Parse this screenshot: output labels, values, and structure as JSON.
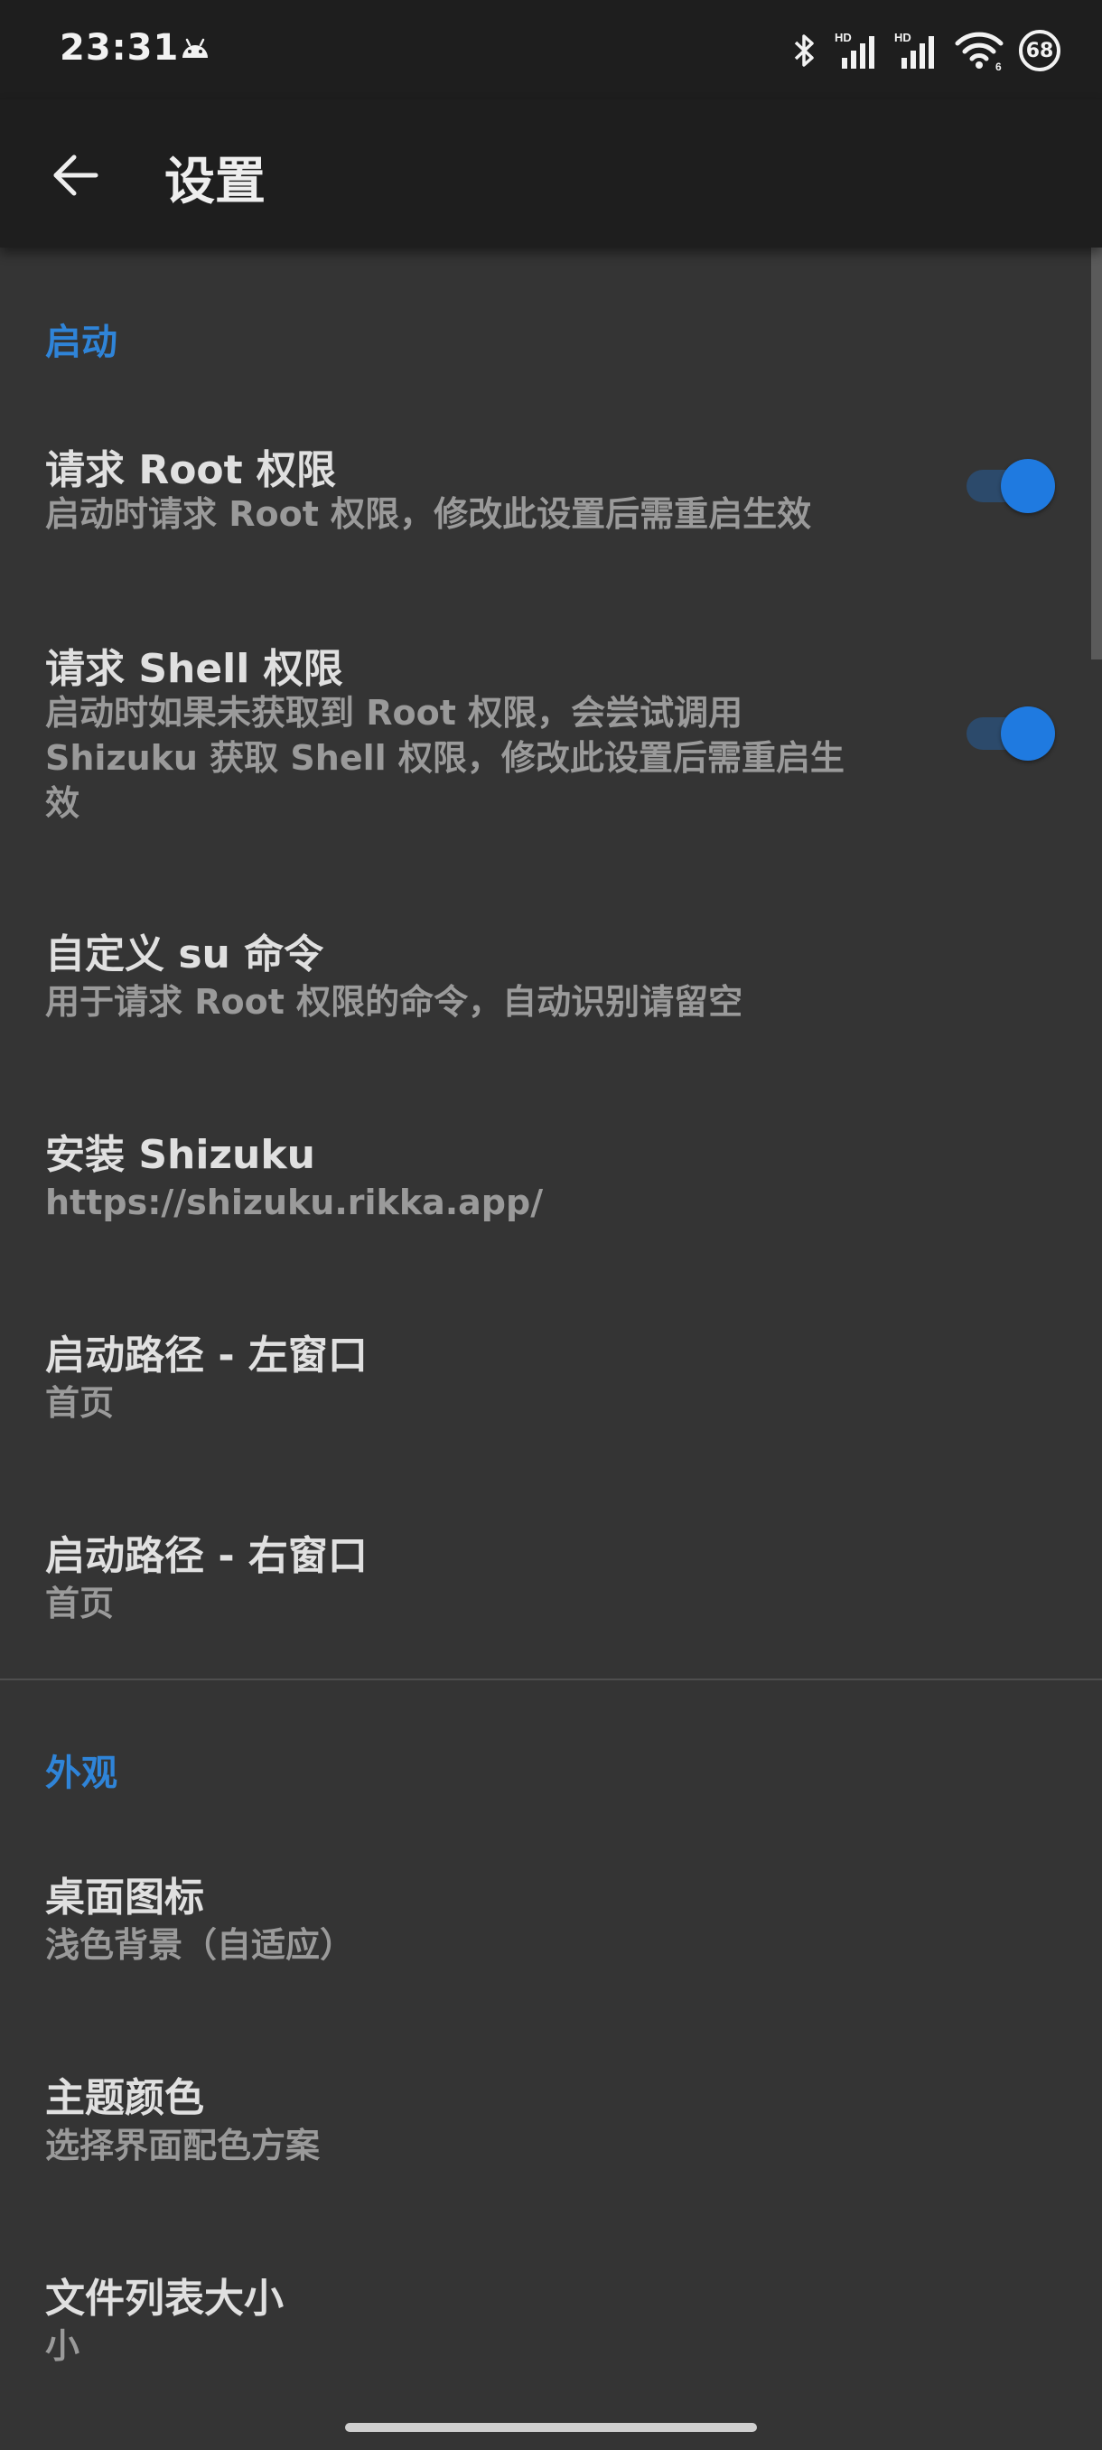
{
  "status_bar": {
    "time": "23:31",
    "battery_level": "68",
    "icons": [
      "android-icon",
      "bluetooth-icon",
      "signal-hd-icon",
      "signal-hd-icon",
      "wifi-icon",
      "battery-icon"
    ]
  },
  "app_bar": {
    "title": "设置",
    "back_icon": "arrow-back-icon"
  },
  "sections": {
    "startup": {
      "header": "启动",
      "items": [
        {
          "title": "请求 Root 权限",
          "summary": "启动时请求 Root 权限，修改此设置后需重启生效",
          "toggle": true
        },
        {
          "title": "请求 Shell 权限",
          "summary_lines": [
            "启动时如果未获取到 Root 权限，会尝试调用",
            "Shizuku 获取 Shell 权限，修改此设置后需重启生",
            "效"
          ],
          "toggle": true
        },
        {
          "title": "自定义 su 命令",
          "summary": "用于请求 Root 权限的命令，自动识别请留空"
        },
        {
          "title": "安装 Shizuku",
          "summary": "https://shizuku.rikka.app/"
        },
        {
          "title": "启动路径 - 左窗口",
          "summary": "首页"
        },
        {
          "title": "启动路径 - 右窗口",
          "summary": "首页"
        }
      ]
    },
    "appearance": {
      "header": "外观",
      "items": [
        {
          "title": "桌面图标",
          "summary": "浅色背景（自适应）"
        },
        {
          "title": "主题颜色",
          "summary": "选择界面配色方案"
        },
        {
          "title": "文件列表大小",
          "summary": "小"
        }
      ]
    }
  },
  "colors": {
    "accent": "#2f84d8",
    "switch_thumb": "#1f7ae0",
    "background": "#343434",
    "app_bar": "#1e1e1e"
  }
}
